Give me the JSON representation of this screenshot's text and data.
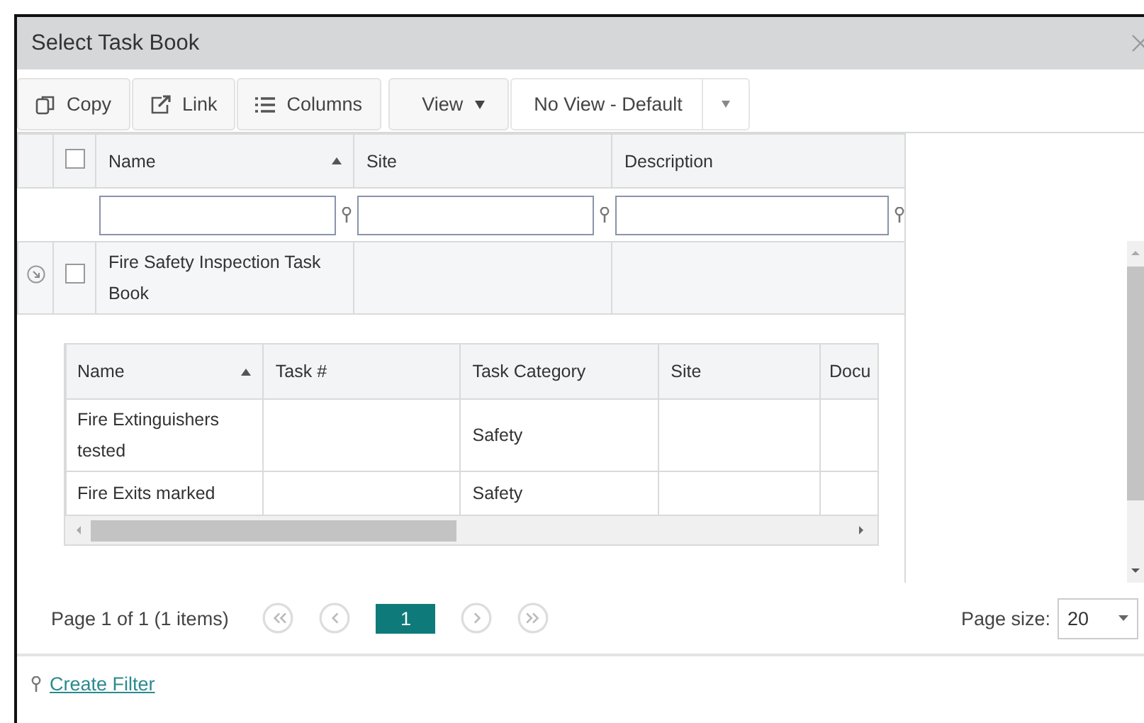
{
  "window": {
    "title": "Select Task Book"
  },
  "toolbar": {
    "buttons": [
      {
        "label": "Copy",
        "kind": "copy"
      },
      {
        "label": "Link",
        "kind": "link"
      },
      {
        "label": "Columns",
        "kind": "columns"
      },
      {
        "label": "View",
        "kind": "dropdown"
      }
    ],
    "view_selector": {
      "value": "No View - Default"
    }
  },
  "grid": {
    "select_all_checked": false,
    "columns": [
      {
        "label": "Name",
        "sorted": true
      },
      {
        "label": "Site",
        "sorted": false
      },
      {
        "label": "Description",
        "sorted": false
      }
    ],
    "rows": [
      {
        "name": "Fire Safety Inspection Task Book",
        "checked": false,
        "expanded": true,
        "detail": {
          "columns": [
            {
              "label": "Name",
              "sorted": true
            },
            {
              "label": "Task #",
              "sorted": false
            },
            {
              "label": "Task Category",
              "sorted": false
            },
            {
              "label": "Site",
              "sorted": false
            },
            {
              "label": "Docu",
              "sorted": false
            }
          ],
          "rows": [
            {
              "name": "Fire Extinguishers tested",
              "task_category": "Safety"
            },
            {
              "name": "Fire Exits marked",
              "task_category": "Safety"
            }
          ]
        }
      }
    ]
  },
  "pager": {
    "summary": "Page 1 of 1 (1 items)",
    "pages": [
      {
        "label": "1",
        "selected": true
      }
    ],
    "page_size_label": "Page size:",
    "page_size": "20"
  },
  "footer": {
    "link": "Create Filter"
  }
}
